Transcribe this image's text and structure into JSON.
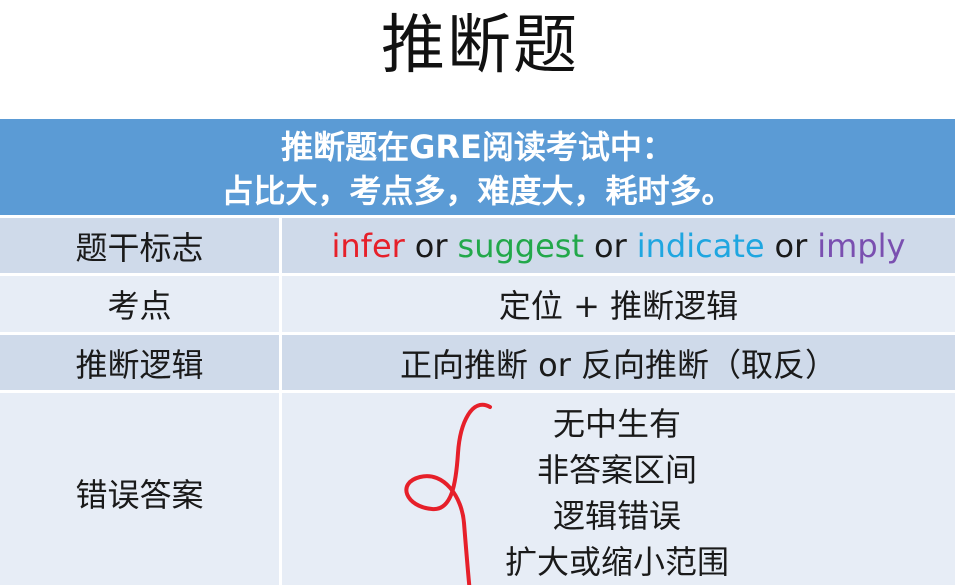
{
  "title": "推断题",
  "header": {
    "line1": "推断题在GRE阅读考试中：",
    "line2": "占比大，考点多，难度大，耗时多。"
  },
  "rows": [
    {
      "label": "题干标志",
      "keywords": [
        {
          "text": "infer",
          "color": "#e6202a"
        },
        {
          "text": "suggest",
          "color": "#22a84a"
        },
        {
          "text": "indicate",
          "color": "#1fa6e0"
        },
        {
          "text": "imply",
          "color": "#7a4fb0"
        }
      ],
      "connector": "or"
    },
    {
      "label": "考点",
      "value": "定位 + 推断逻辑"
    },
    {
      "label": "推断逻辑",
      "value": "正向推断 or 反向推断（取反）"
    },
    {
      "label": "错误答案",
      "items": [
        "无中生有",
        "非答案区间",
        "逻辑错误",
        "扩大或缩小范围"
      ]
    }
  ],
  "colors": {
    "header_bg": "#5b9bd5",
    "row_dark": "#cfdaea",
    "row_light": "#e7edf6",
    "annotation_ink": "#e6202a"
  }
}
